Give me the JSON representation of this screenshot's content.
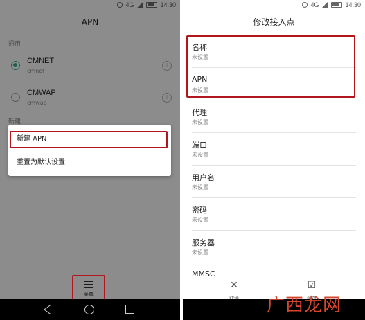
{
  "left": {
    "status": {
      "network": "4G",
      "time": "14:30"
    },
    "title": "APN",
    "section_common": "通用",
    "apns": [
      {
        "name": "CMNET",
        "sub": "cmnet",
        "selected": true
      },
      {
        "name": "CMWAP",
        "sub": "cmwap",
        "selected": false
      }
    ],
    "section_new": "新建",
    "popup_items": [
      "新建 APN",
      "重置为默认设置"
    ],
    "menu_label": "菜单"
  },
  "right": {
    "status": {
      "network": "4G",
      "time": "14:30"
    },
    "title": "修改接入点",
    "fields": [
      {
        "label": "名称",
        "value": "未设置"
      },
      {
        "label": "APN",
        "value": "未设置"
      },
      {
        "label": "代理",
        "value": "未设置"
      },
      {
        "label": "端口",
        "value": "未设置"
      },
      {
        "label": "用户名",
        "value": "未设置"
      },
      {
        "label": "密码",
        "value": "未设置"
      },
      {
        "label": "服务器",
        "value": "未设置"
      },
      {
        "label": "MMSC",
        "value": ""
      }
    ],
    "actions": {
      "cancel_label": "取消",
      "save_label": "保存"
    }
  },
  "watermark": "广西龙网",
  "colors": {
    "highlight": "#b1161c",
    "accent": "#2aa690",
    "watermark": "#d6452d"
  }
}
